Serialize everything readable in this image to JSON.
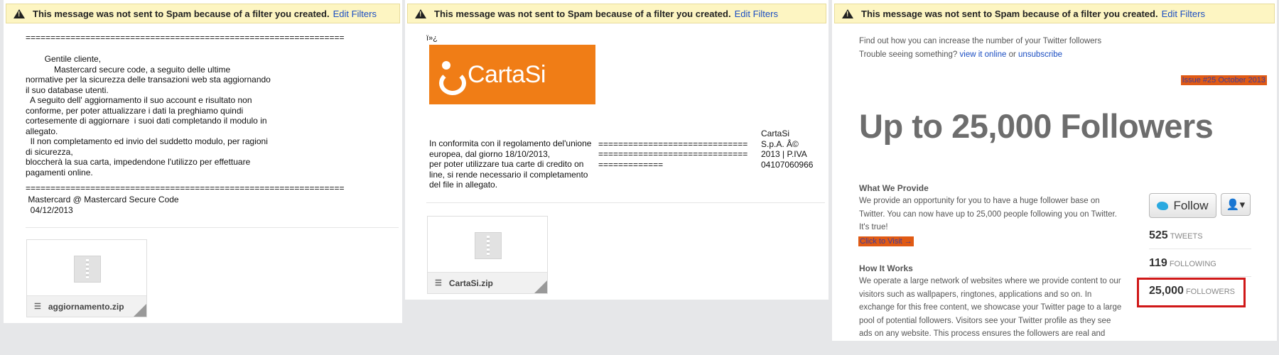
{
  "banner": {
    "message": "This message was not sent to Spam because of a filter you created.",
    "link": "Edit Filters"
  },
  "email1": {
    "rule": "================================================================",
    "body": "        Gentile cliente,\n            Mastercard secure code, a seguito delle ultime\nnormative per la sicurezza delle transazioni web sta aggiornando\nil suo database utenti.\n  A seguito dell' aggiornamento il suo account e risultato non\nconforme, per poter attualizzare i dati la preghiamo quindi\ncortesemente di aggiornare  i suoi dati completando il modulo in\nallegato.\n  Il non completamento ed invio del suddetto modulo, per ragioni\ndi sicurezza,\nbloccherà la sua carta, impedendone l'utilizzo per effettuare\npagamenti online.",
    "rule2": "================================================================",
    "signature": " Mastercard @ Mastercard Secure Code\n  04/12/2013",
    "attachment": "aggiornamento.zip"
  },
  "email2": {
    "garbled": "ï»¿",
    "logo": "CartaSi",
    "col1": "In conformita con il regolamento del'unione\neuropea, dal giorno 18/10/2013,\nper poter utilizzare tua carte di credito on\nline, si rende necessario il completamento\ndel file in allegato.",
    "col2": "\n==============================\n==============================\n=============",
    "col3": "CartaSi\nS.p.A. Â©\n2013 | P.IVA\n04107060966",
    "attachment": "CartaSi.zip"
  },
  "email3": {
    "intro_line": "Find out how you can increase the number of your Twitter followers",
    "trouble_text": "Trouble seeing something?",
    "view_online": "view it online",
    "or_text": "or",
    "unsubscribe": "unsubscribe",
    "issue": "Issue #25 October 2013",
    "headline": "Up to 25,000 Followers",
    "provide_heading": "What We Provide",
    "provide_text": "We provide an opportunity for you to have a huge follower base on Twitter. You can now have up to 25,000 people following you on Twitter. It's true!",
    "visit": "Click to Visit →",
    "how_heading": "How It Works",
    "how_text": "We operate a large network of websites where we provide content to our visitors such as wallpapers, ringtones, applications and so on. In exchange for this free content, we showcase your Twitter page to a large pool of potential followers. Visitors see your Twitter profile as they see ads on any website. This process ensures the followers are real and",
    "follow_label": "Follow",
    "user_menu": "👤▾",
    "tweets_count": "525",
    "tweets_label": "TWEETS",
    "following_count": "119",
    "following_label": "FOLLOWING",
    "followers_count": "25,000",
    "followers_label": "FOLLOWERS"
  },
  "colors": {
    "banner_bg": "#fdf5c2",
    "cartasi_orange": "#f07d16",
    "link_blue": "#1a4dc2",
    "highlight_red": "#d01818"
  }
}
